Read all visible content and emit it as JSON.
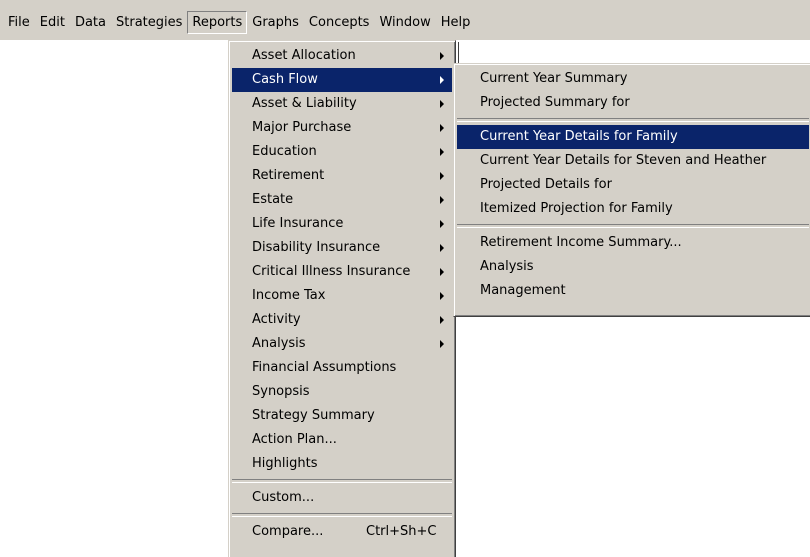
{
  "menubar": {
    "items": [
      {
        "label": "File"
      },
      {
        "label": "Edit"
      },
      {
        "label": "Data"
      },
      {
        "label": "Strategies"
      },
      {
        "label": "Reports"
      },
      {
        "label": "Graphs"
      },
      {
        "label": "Concepts"
      },
      {
        "label": "Window"
      },
      {
        "label": "Help"
      }
    ]
  },
  "reports_menu": {
    "items": [
      {
        "label": "Asset Allocation"
      },
      {
        "label": "Cash Flow"
      },
      {
        "label": "Asset & Liability"
      },
      {
        "label": "Major Purchase"
      },
      {
        "label": "Education"
      },
      {
        "label": "Retirement"
      },
      {
        "label": "Estate"
      },
      {
        "label": "Life Insurance"
      },
      {
        "label": "Disability Insurance"
      },
      {
        "label": "Critical Illness Insurance"
      },
      {
        "label": "Income Tax"
      },
      {
        "label": "Activity"
      },
      {
        "label": "Analysis"
      },
      {
        "label": "Financial Assumptions"
      },
      {
        "label": "Synopsis"
      },
      {
        "label": "Strategy Summary"
      },
      {
        "label": "Action Plan..."
      },
      {
        "label": "Highlights"
      },
      {
        "label": "Custom..."
      },
      {
        "label": "Compare...",
        "shortcut": "Ctrl+Sh+C"
      }
    ]
  },
  "cashflow_menu": {
    "items": [
      {
        "label": "Current Year Summary"
      },
      {
        "label": "Projected Summary for"
      },
      {
        "label": "Current Year Details for Family"
      },
      {
        "label": "Current Year Details for Steven and Heather"
      },
      {
        "label": "Projected Details for"
      },
      {
        "label": "Itemized Projection for Family"
      },
      {
        "label": "Retirement Income Summary..."
      },
      {
        "label": "Analysis"
      },
      {
        "label": "Management"
      }
    ]
  }
}
